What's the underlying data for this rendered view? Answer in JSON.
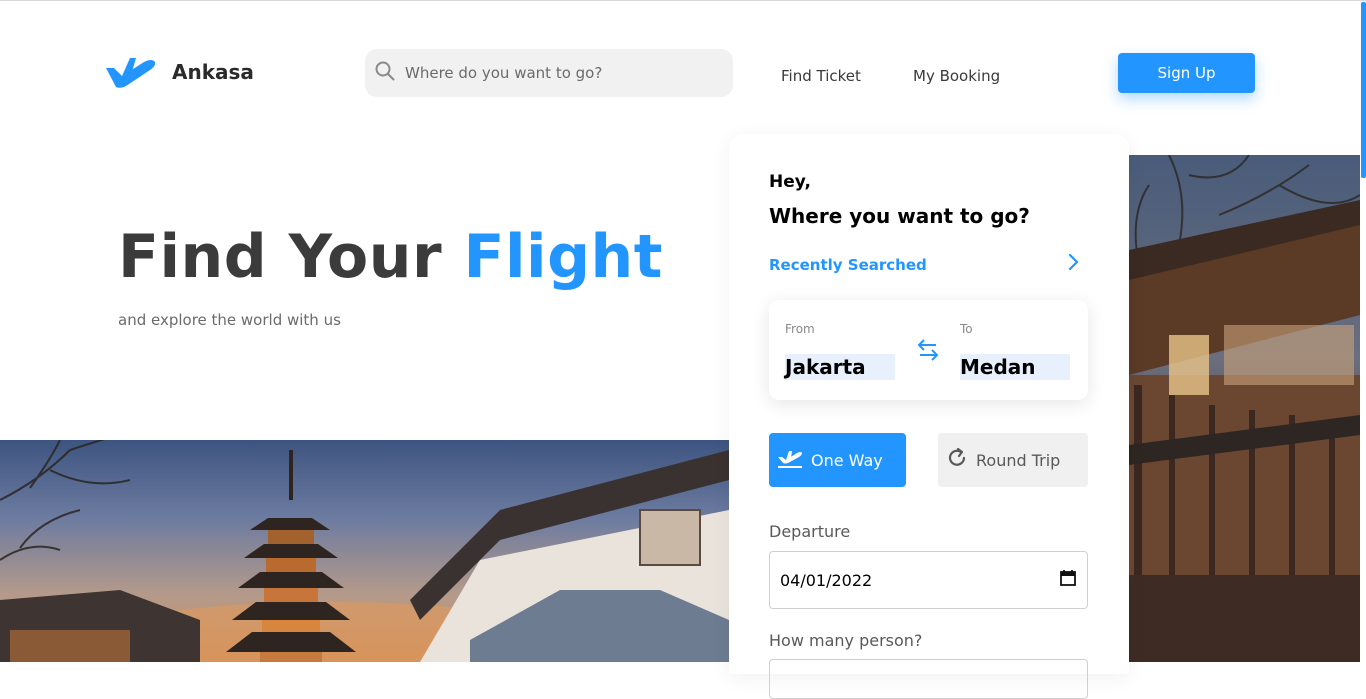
{
  "header": {
    "brand": "Ankasa",
    "search_placeholder": "Where do you want to go?",
    "nav": [
      "Find Ticket",
      "My Booking"
    ],
    "signup_label": "Sign Up"
  },
  "hero": {
    "title_part1": "Find Your ",
    "title_part2": "Flight",
    "subtitle": "and explore the world with us"
  },
  "booking": {
    "greeting": "Hey,",
    "question": "Where you want to go?",
    "recent_label": "Recently Searched",
    "from_label": "From",
    "from_value": "Jakarta",
    "to_label": "To",
    "to_value": "Medan",
    "one_way_label": "One Way",
    "round_trip_label": "Round Trip",
    "departure_label": "Departure",
    "departure_value": "04/01/2022",
    "persons_label": "How many person?"
  },
  "colors": {
    "accent": "#2395ff",
    "text_dark": "#3b3b3b"
  },
  "icons": [
    "plane-logo-icon",
    "search-icon",
    "chevron-right-icon",
    "swap-arrows-icon",
    "plane-takeoff-icon",
    "refresh-icon",
    "calendar-icon"
  ]
}
